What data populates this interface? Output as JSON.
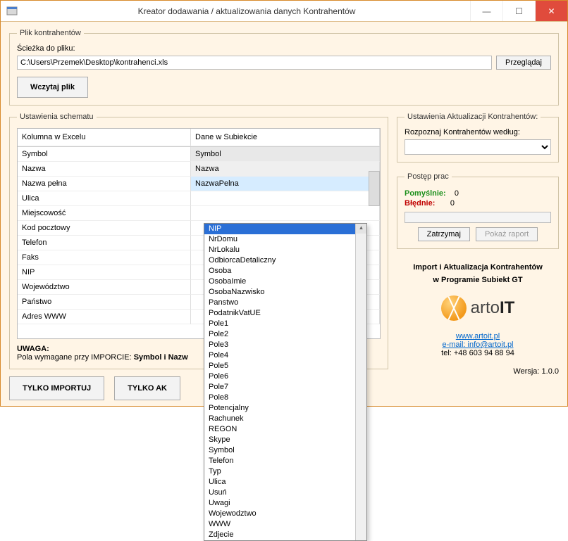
{
  "window": {
    "title": "Kreator dodawania / aktualizowania danych Kontrahentów"
  },
  "file_group": {
    "legend": "Plik kontrahentów",
    "path_label": "Ścieżka do pliku:",
    "path_value": "C:\\Users\\Przemek\\Desktop\\kontrahenci.xls",
    "browse": "Przeglądaj",
    "load": "Wczytaj plik"
  },
  "schema": {
    "legend": "Ustawienia schematu",
    "col_excel": "Kolumna w Excelu",
    "col_subiekt": "Dane w Subiekcie",
    "rows": [
      {
        "excel": "Symbol",
        "sub": "Symbol"
      },
      {
        "excel": "Nazwa",
        "sub": "Nazwa"
      },
      {
        "excel": "Nazwa pełna",
        "sub": "NazwaPelna"
      },
      {
        "excel": "Ulica",
        "sub": ""
      },
      {
        "excel": "Miejscowość",
        "sub": ""
      },
      {
        "excel": "Kod pocztowy",
        "sub": ""
      },
      {
        "excel": "Telefon",
        "sub": ""
      },
      {
        "excel": "Faks",
        "sub": ""
      },
      {
        "excel": "NIP",
        "sub": ""
      },
      {
        "excel": "Województwo",
        "sub": ""
      },
      {
        "excel": "Państwo",
        "sub": ""
      },
      {
        "excel": "Adres WWW",
        "sub": ""
      }
    ],
    "warning_title": "UWAGA:",
    "warning_line": "Pola wymagane przy IMPORCIE:",
    "warning_bold": "Symbol i Nazw"
  },
  "dropdown_options": [
    "NIP",
    "NrDomu",
    "NrLokalu",
    "OdbiorcaDetaliczny",
    "Osoba",
    "OsobaImie",
    "OsobaNazwisko",
    "Panstwo",
    "PodatnikVatUE",
    "Pole1",
    "Pole2",
    "Pole3",
    "Pole4",
    "Pole5",
    "Pole6",
    "Pole7",
    "Pole8",
    "Potencjalny",
    "Rachunek",
    "REGON",
    "Skype",
    "Symbol",
    "Telefon",
    "Typ",
    "Ulica",
    "Usuń",
    "Uwagi",
    "Wojewodztwo",
    "WWW",
    "Zdjecie"
  ],
  "dropdown_selected": "NIP",
  "actions": {
    "import_only": "TYLKO IMPORTUJ",
    "update_only": "TYLKO AK"
  },
  "update_group": {
    "legend": "Ustawienia Aktualizacji Kontrahentów:",
    "recognize_label": "Rozpoznaj Kontrahentów według:",
    "selected": ""
  },
  "progress": {
    "legend": "Postęp prac",
    "success_label": "Pomyślnie:",
    "success_value": "0",
    "error_label": "Błędnie:",
    "error_value": "0",
    "stop": "Zatrzymaj",
    "report": "Pokaż raport"
  },
  "info": {
    "line1": "Import i Aktualizacja Kontrahentów",
    "line2": "w Programie Subiekt GT",
    "brand_a": "arto",
    "brand_b": "IT",
    "link_site": "www.artoit.pl",
    "link_mail": "e-mail: info@artoit.pl",
    "tel": "tel: +48 603 94 88 94"
  },
  "version": "Wersja: 1.0.0"
}
